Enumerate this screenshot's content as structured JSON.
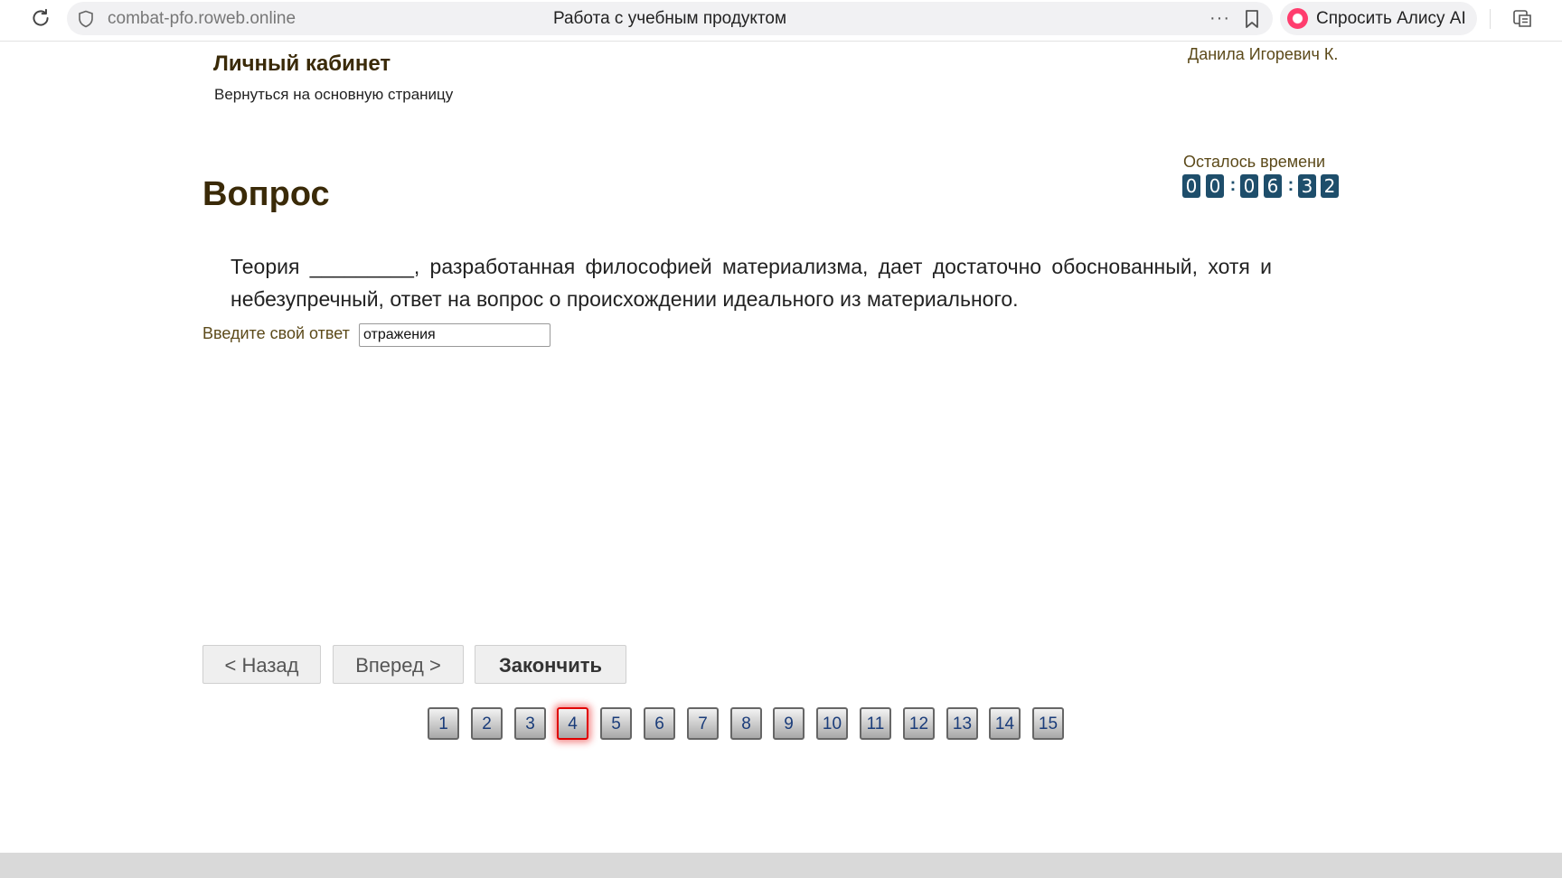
{
  "browser": {
    "url": "combat-pfo.roweb.online",
    "tab_title": "Работа с учебным продуктом",
    "more_label": "···",
    "alice_label": "Спросить Алису AI"
  },
  "header": {
    "cabinet_title": "Личный кабинет",
    "back_link": "Вернуться на основную страницу",
    "user_name": "Данила Игоревич К."
  },
  "timer": {
    "label": "Осталось времени",
    "digits": [
      "0",
      "0",
      "0",
      "6",
      "3",
      "2"
    ],
    "separator": ":"
  },
  "question": {
    "title": "Вопрос",
    "text": "Теория _________, разработанная философией материализма, дает достаточно обоснованный, хотя и небезупречный, ответ на вопрос о происхождении идеального из материального.",
    "answer_label": "Введите свой ответ",
    "answer_value": "отражения"
  },
  "navigation": {
    "back_label": "< Назад",
    "forward_label": "Вперед >",
    "finish_label": "Закончить"
  },
  "question_nav": {
    "current": 4,
    "items": [
      "1",
      "2",
      "3",
      "4",
      "5",
      "6",
      "7",
      "8",
      "9",
      "10",
      "11",
      "12",
      "13",
      "14",
      "15"
    ]
  },
  "colors": {
    "title_brown": "#3a2a08",
    "label_brown": "#5c4a1a",
    "timer_blue": "#1e4e6b",
    "current_red": "#e00000"
  }
}
